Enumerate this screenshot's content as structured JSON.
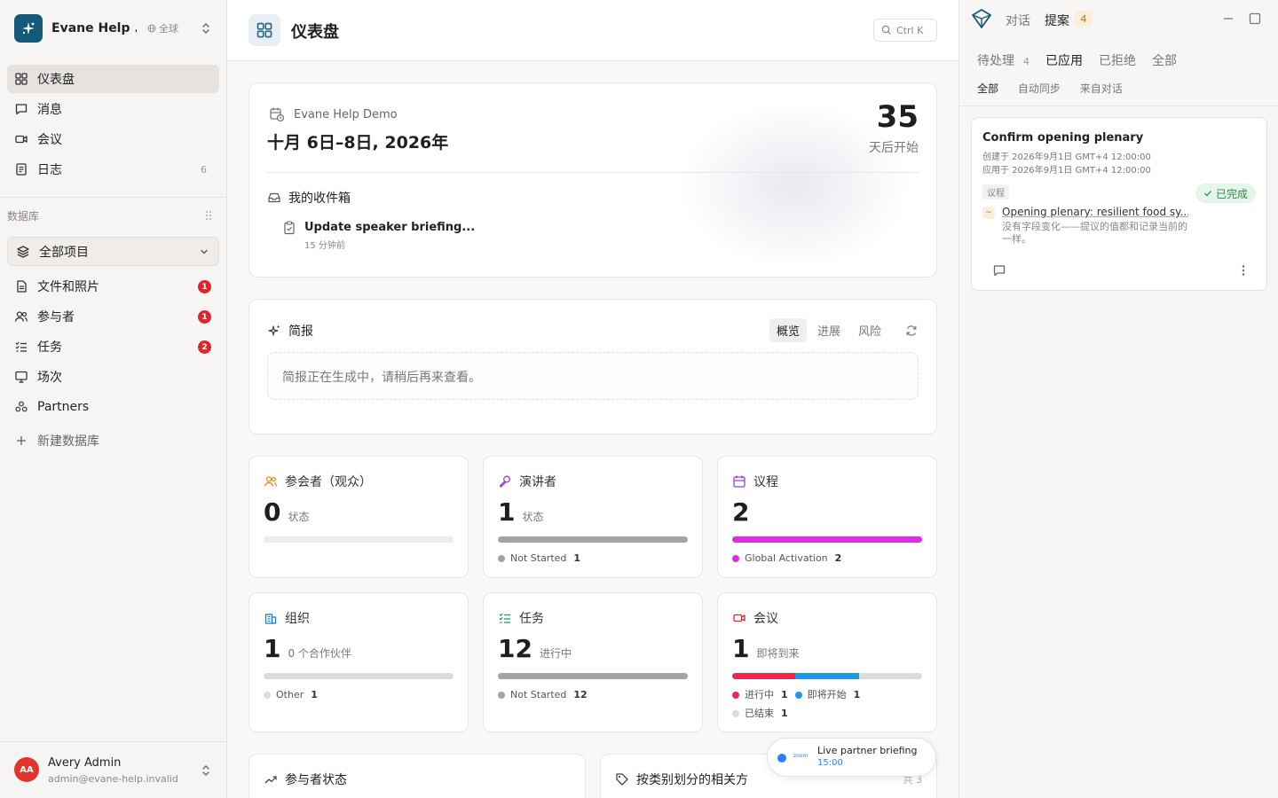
{
  "workspace": {
    "name": "Evane Help ...",
    "scope": "全球"
  },
  "nav": [
    {
      "label": "仪表盘"
    },
    {
      "label": "消息"
    },
    {
      "label": "会议"
    },
    {
      "label": "日志",
      "count": "6"
    }
  ],
  "database": {
    "section_label": "数据库",
    "all_items": "全部项目",
    "items": [
      {
        "label": "文件和照片",
        "badge": "1"
      },
      {
        "label": "参与者",
        "badge": "1"
      },
      {
        "label": "任务",
        "badge": "2"
      },
      {
        "label": "场次"
      },
      {
        "label": "Partners"
      }
    ],
    "new_db": "新建数据库"
  },
  "user": {
    "initials": "AA",
    "name": "Avery Admin",
    "email": "admin@evane-help.invalid"
  },
  "header": {
    "title": "仪表盘",
    "search_shortcut": "Ctrl K"
  },
  "event": {
    "name": "Evane Help Demo",
    "dates": "十月 6日–8日, 2026年",
    "days_until": "35",
    "days_label": "天后开始",
    "inbox_title": "我的收件箱",
    "inbox_item_title": "Update speaker briefing...",
    "inbox_item_time": "15 分钟前"
  },
  "briefing": {
    "title": "简报",
    "tabs": [
      "概览",
      "进展",
      "风险"
    ],
    "placeholder": "简报正在生成中，请稍后再来查看。"
  },
  "stats": [
    {
      "title": "参会者（观众）",
      "value": "0",
      "sub": "状态",
      "legend": [],
      "bar": []
    },
    {
      "title": "演讲者",
      "value": "1",
      "sub": "状态",
      "bar": [
        {
          "fraction": 1.0,
          "color": "#a3a3ab"
        }
      ],
      "legend": [
        {
          "label": "Not Started",
          "count": "1",
          "color": "#a3a3ab"
        }
      ]
    },
    {
      "title": "议程",
      "value": "2",
      "sub": "",
      "bar": [
        {
          "fraction": 1.0,
          "color": "#e12ae6"
        }
      ],
      "legend": [
        {
          "label": "Global Activation",
          "count": "2",
          "color": "#e12ae6"
        }
      ]
    },
    {
      "title": "组织",
      "value": "1",
      "sub": "0 个合作伙伴",
      "bar": [
        {
          "fraction": 1.0,
          "color": "#dcdce0"
        }
      ],
      "legend": [
        {
          "label": "Other",
          "count": "1",
          "color": "#dcdce0"
        }
      ]
    },
    {
      "title": "任务",
      "value": "12",
      "sub": "进行中",
      "bar": [
        {
          "fraction": 1.0,
          "color": "#a3a3ab"
        }
      ],
      "legend": [
        {
          "label": "Not Started",
          "count": "12",
          "color": "#a3a3ab"
        }
      ]
    },
    {
      "title": "会议",
      "value": "1",
      "sub": "即将到来",
      "bar": [
        {
          "fraction": 0.333,
          "color": "#f0264e"
        },
        {
          "fraction": 0.334,
          "color": "#1e97e6"
        },
        {
          "fraction": 0.333,
          "color": "#dcdce0"
        }
      ],
      "legend": [
        {
          "label": "进行中",
          "count": "1",
          "color": "#f0264e"
        },
        {
          "label": "即将开始",
          "count": "1",
          "color": "#1e97e6"
        },
        {
          "label": "已结束",
          "count": "1",
          "color": "#dcdce0"
        }
      ]
    }
  ],
  "bottom": {
    "left_title": "参与者状态",
    "right_title": "按类别划分的相关方",
    "right_total": "共 3"
  },
  "toast": {
    "app": "zoom",
    "title": "Live partner briefing",
    "time": "15:00"
  },
  "panel": {
    "tabs": [
      "对话",
      "提案"
    ],
    "proposal_count": "4",
    "filters": [
      {
        "label": "待处理",
        "count": "4"
      },
      {
        "label": "已应用"
      },
      {
        "label": "已拒绝"
      },
      {
        "label": "全部"
      }
    ],
    "subfilters": [
      "全部",
      "自动同步",
      "来自对话"
    ],
    "proposal": {
      "title": "Confirm opening plenary",
      "created": "创建于 2026年9月1日 GMT+4 12:00:00",
      "applied": "应用于 2026年9月1日 GMT+4 12:00:00",
      "tag": "议程",
      "status": "已完成",
      "link": "Opening plenary: resilient food sy...",
      "description": "没有字段变化——提议的值都和记录当前的一样。"
    }
  }
}
